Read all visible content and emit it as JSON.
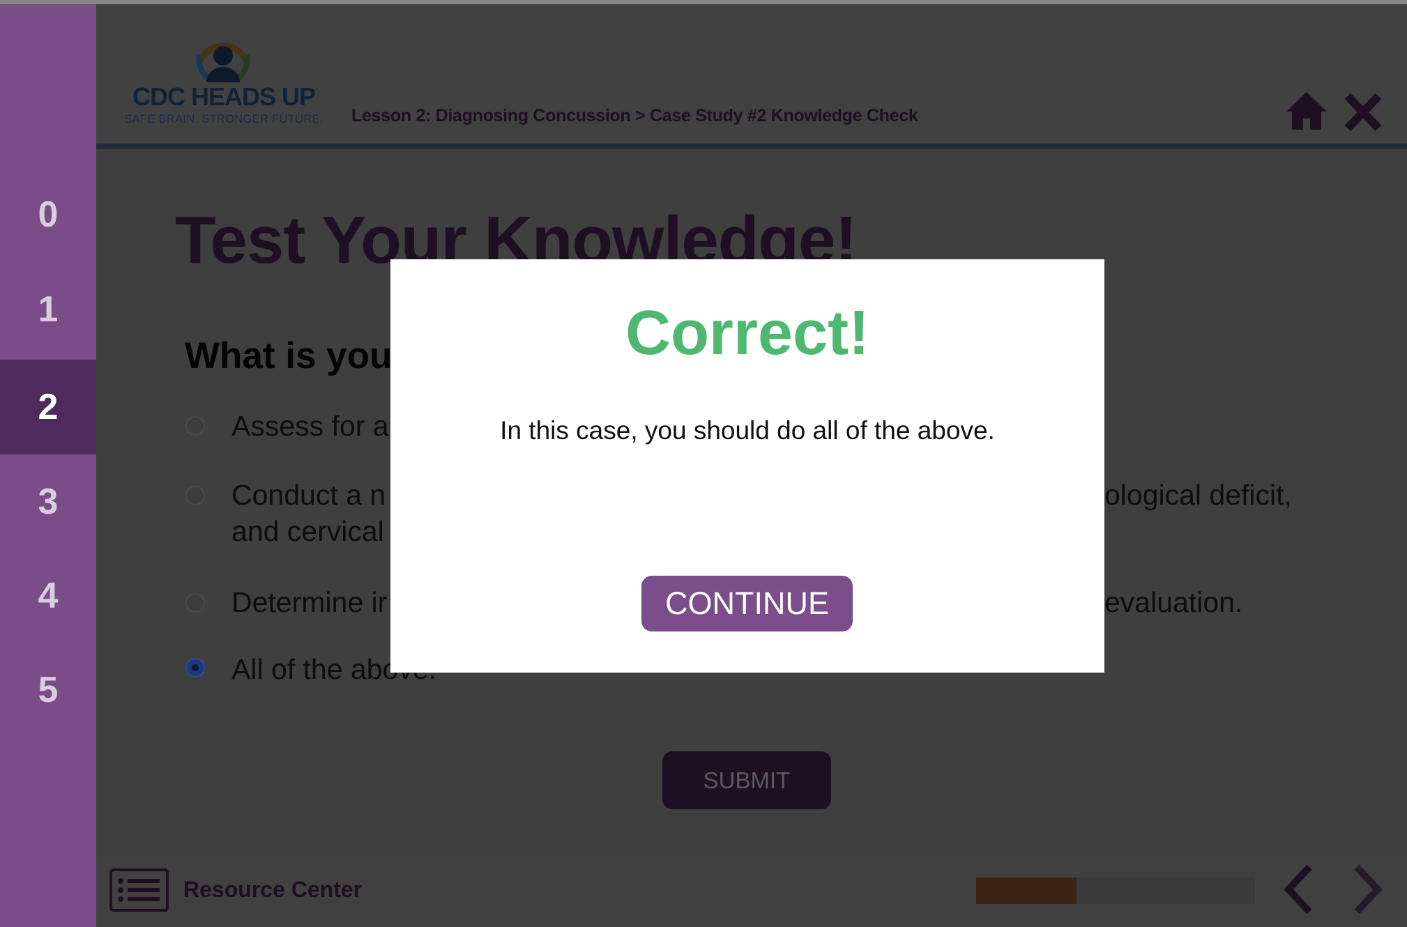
{
  "sidebar": {
    "items": [
      {
        "label": "0"
      },
      {
        "label": "1"
      },
      {
        "label": "2",
        "active": true
      },
      {
        "label": "3"
      },
      {
        "label": "4"
      },
      {
        "label": "5"
      }
    ]
  },
  "header": {
    "logo_title": "CDC HEADS UP",
    "logo_tagline": "SAFE BRAIN. STRONGER FUTURE.",
    "breadcrumb": "Lesson 2: Diagnosing Concussion > Case Study #2 Knowledge Check",
    "home_icon": "home-icon",
    "close_icon": "close-icon"
  },
  "main": {
    "title": "Test Your Knowledge!",
    "question": "What is you",
    "options": [
      {
        "left": "Assess for a",
        "selected": false
      },
      {
        "left": "Conduct a n",
        "right": "ological deficit,",
        "left2": "and cervical",
        "selected": false
      },
      {
        "left": "Determine ir",
        "right": "evaluation.",
        "selected": false
      },
      {
        "left": "All of the above.",
        "selected": true
      }
    ],
    "submit_label": "SUBMIT"
  },
  "footer": {
    "resource_label": "Resource Center",
    "progress_percent": 36
  },
  "modal": {
    "heading": "Correct!",
    "message": "In this case, you should do all of the above.",
    "continue_label": "CONTINUE",
    "heading_color": "#4fb870",
    "button_color": "#7b4d8b"
  }
}
